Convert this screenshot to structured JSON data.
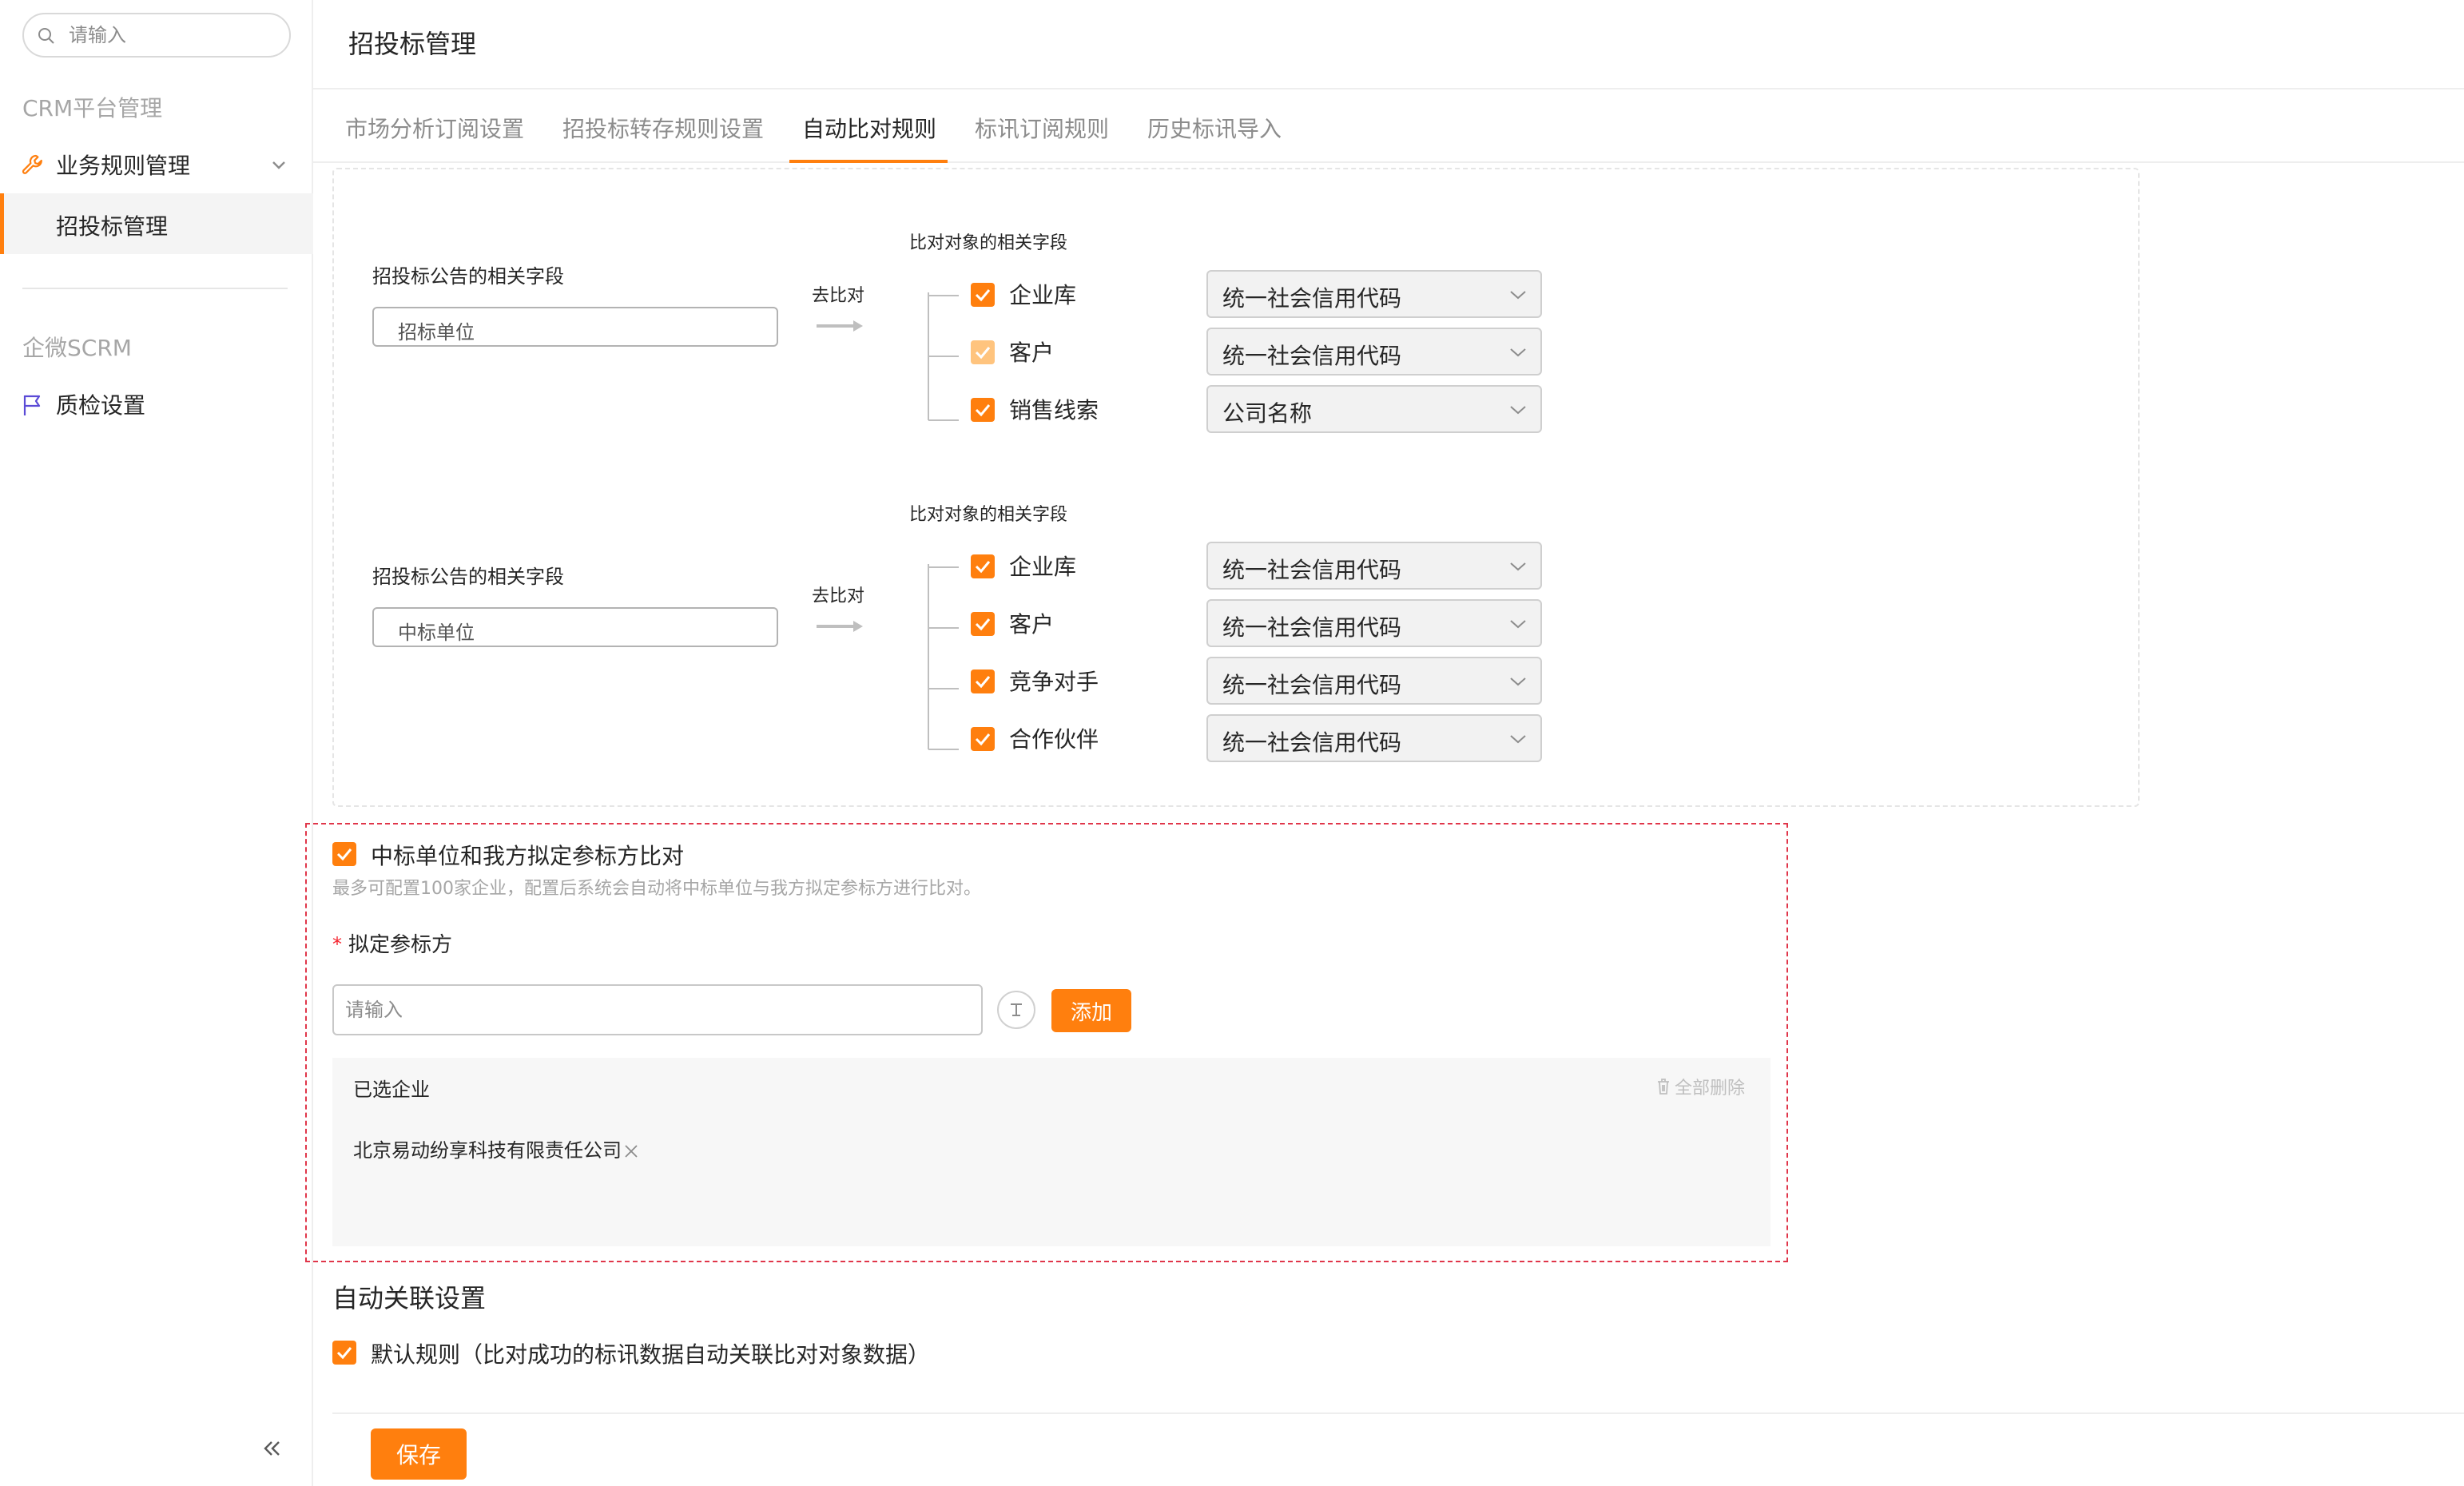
{
  "sidebar": {
    "search_placeholder": "请输入",
    "section_crm": "CRM平台管理",
    "nav_business_rules": "业务规则管理",
    "nav_bidding": "招投标管理",
    "section_scrm": "企微SCRM",
    "nav_quality": "质检设置"
  },
  "header": {
    "title": "招投标管理"
  },
  "tabs": [
    "市场分析订阅设置",
    "招投标转存规则设置",
    "自动比对规则",
    "标讯订阅规则",
    "历史标讯导入"
  ],
  "active_tab_index": 2,
  "rule1": {
    "source_label": "招投标公告的相关字段",
    "source_value": "招标单位",
    "compare_label": "去比对",
    "target_label": "比对对象的相关字段",
    "targets": [
      {
        "name": "企业库",
        "checked": true,
        "field": "统一社会信用代码"
      },
      {
        "name": "客户",
        "checked": true,
        "disabled": true,
        "field": "统一社会信用代码"
      },
      {
        "name": "销售线索",
        "checked": true,
        "field": "公司名称"
      }
    ]
  },
  "rule2": {
    "source_label": "招投标公告的相关字段",
    "source_value": "中标单位",
    "compare_label": "去比对",
    "target_label": "比对对象的相关字段",
    "targets": [
      {
        "name": "企业库",
        "checked": true,
        "field": "统一社会信用代码"
      },
      {
        "name": "客户",
        "checked": true,
        "field": "统一社会信用代码"
      },
      {
        "name": "竞争对手",
        "checked": true,
        "field": "统一社会信用代码"
      },
      {
        "name": "合作伙伴",
        "checked": true,
        "field": "统一社会信用代码"
      }
    ]
  },
  "panel": {
    "check_label": "中标单位和我方拟定参标方比对",
    "description": "最多可配置100家企业，配置后系统会自动将中标单位与我方拟定参标方进行比对。",
    "required_mark": "*",
    "field_label": "拟定参标方",
    "input_placeholder": "请输入",
    "add_button": "添加",
    "selected_title": "已选企业",
    "clear_all": "全部删除",
    "selected": [
      "北京易动纷享科技有限责任公司"
    ]
  },
  "auto_link": {
    "title": "自动关联设置",
    "default_rule": "默认规则（比对成功的标讯数据自动关联比对对象数据）"
  },
  "footer": {
    "save": "保存"
  },
  "colors": {
    "accent": "#ff7f0e",
    "accent_disabled": "#ffc47e",
    "danger": "#e0364a"
  },
  "icons": {
    "search": "search-icon",
    "wrench": "wrench-icon",
    "flag": "flag-icon",
    "collapse": "double-chevron-left-icon"
  }
}
